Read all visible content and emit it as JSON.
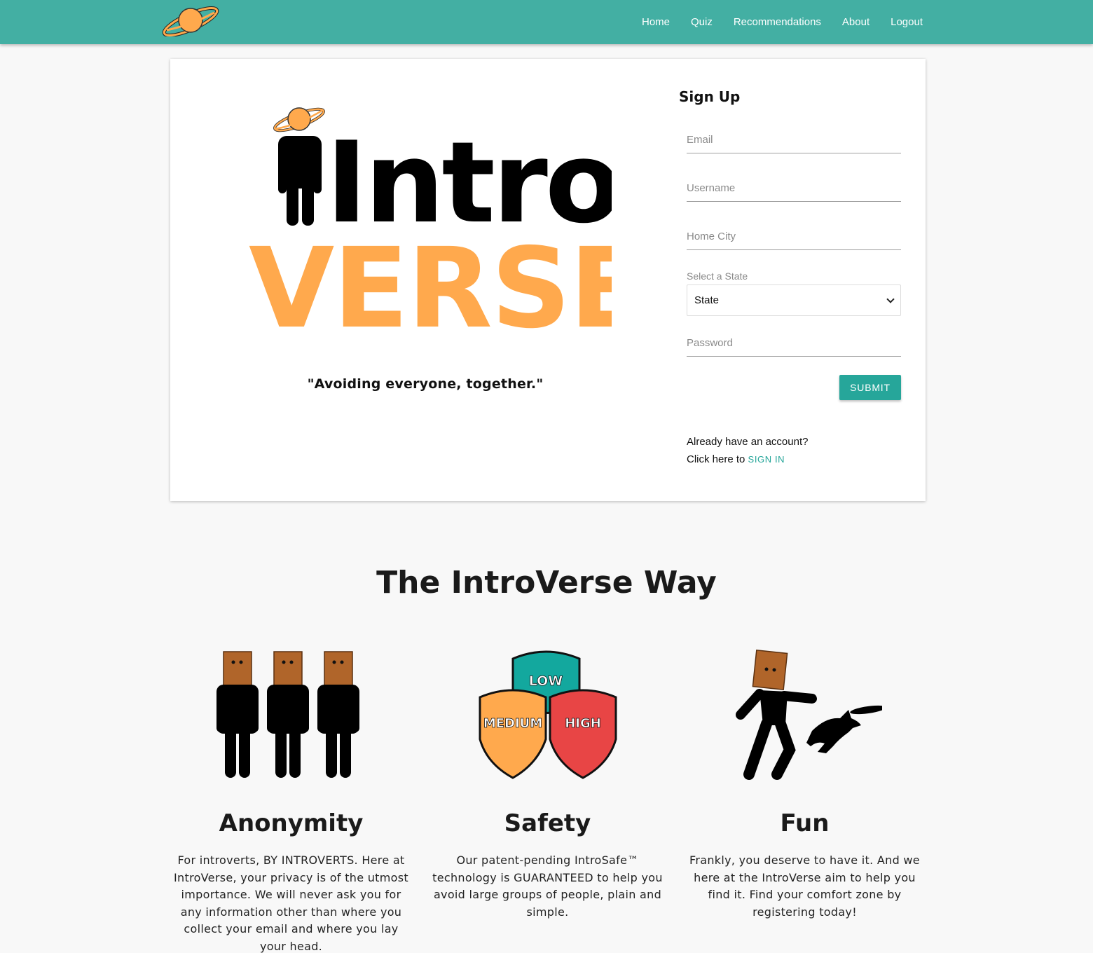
{
  "colors": {
    "navbar": "#43afa3",
    "accent": "#26a69a",
    "orange": "#ffa94d",
    "teal_shield": "#13a89e",
    "red_shield": "#e84545"
  },
  "nav": {
    "logo_icon": "saturn-planet-icon",
    "links": [
      "Home",
      "Quiz",
      "Recommendations",
      "About",
      "Logout"
    ]
  },
  "brand": {
    "logo_word_top": "Intro",
    "logo_word_bottom": "VERSE",
    "tagline": "\"Avoiding everyone, together.\""
  },
  "signup": {
    "title": "Sign Up",
    "email_placeholder": "Email",
    "username_placeholder": "Username",
    "city_placeholder": "Home City",
    "state_label": "Select a State",
    "state_value": "State",
    "password_placeholder": "Password",
    "submit_label": "SUBMIT",
    "account_line1": "Already have an account?",
    "account_line2": "Click here to",
    "signin_label": "SIGN IN"
  },
  "way": {
    "title": "The IntroVerse Way",
    "features": [
      {
        "icon": "three-paper-bag-people-icon",
        "title": "Anonymity",
        "text": "For introverts, BY INTROVERTS. Here at IntroVerse, your privacy is of the utmost importance. We will never ask you for any information other than where you collect your email and where you lay your head."
      },
      {
        "icon": "safety-shields-icon",
        "title": "Safety",
        "shield_labels": [
          "LOW",
          "MEDIUM",
          "HIGH"
        ],
        "text": "Our patent-pending IntroSafe™ technology is GUARANTEED to help you avoid large groups of people, plain and simple."
      },
      {
        "icon": "person-playing-frisbee-with-dog-icon",
        "title": "Fun",
        "text": "Frankly, you deserve to have it. And we here at the IntroVerse aim to help you find it. Find your comfort zone by registering today!"
      }
    ]
  }
}
